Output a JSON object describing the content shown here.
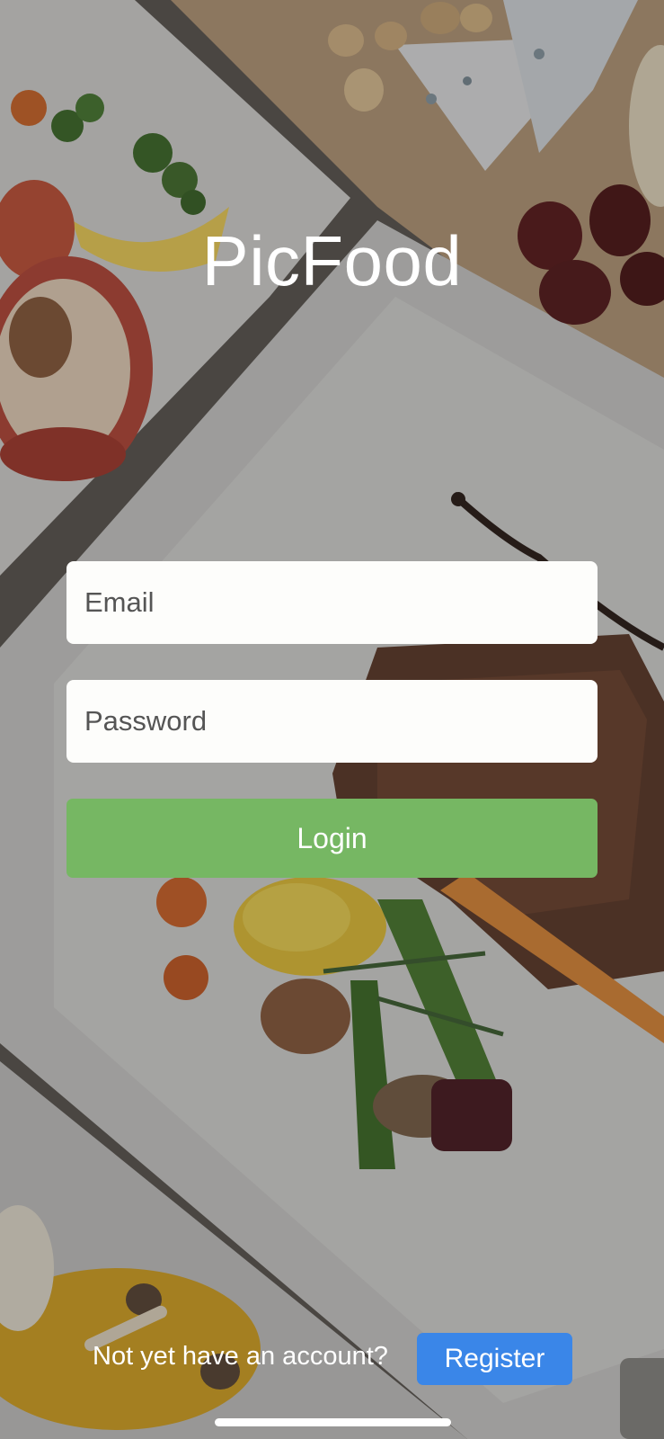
{
  "app": {
    "title": "PicFood"
  },
  "login_form": {
    "email_placeholder": "Email",
    "email_value": "",
    "password_placeholder": "Password",
    "password_value": "",
    "login_label": "Login"
  },
  "register": {
    "prompt": "Not yet have an account?",
    "button_label": "Register"
  },
  "colors": {
    "login_button": "#76b763",
    "register_button": "#3a86e8",
    "field_background": "#fdfdfb"
  },
  "background_image": {
    "icon": "food-photo-background"
  }
}
